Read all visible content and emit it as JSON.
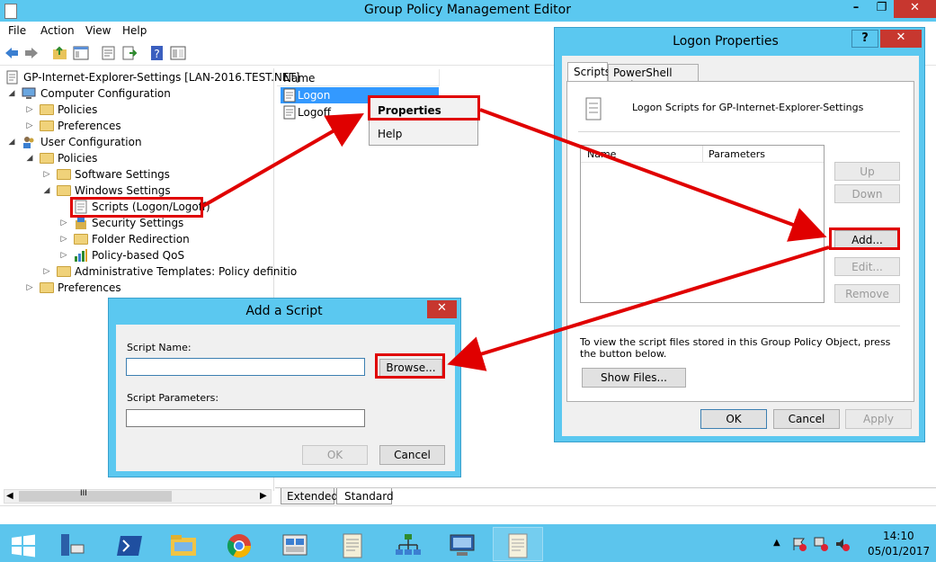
{
  "main_window": {
    "title": "Group Policy Management Editor",
    "menu": [
      "File",
      "Action",
      "View",
      "Help"
    ]
  },
  "tree": {
    "root": "GP-Internet-Explorer-Settings [LAN-2016.TEST.NET]",
    "computer_configuration": "Computer Configuration",
    "cc_policies": "Policies",
    "cc_preferences": "Preferences",
    "user_configuration": "User Configuration",
    "uc_policies": "Policies",
    "software_settings": "Software Settings",
    "windows_settings": "Windows Settings",
    "scripts": "Scripts (Logon/Logoff)",
    "security_settings": "Security Settings",
    "folder_redirection": "Folder Redirection",
    "policy_qos": "Policy-based QoS",
    "admin_templates": "Administrative Templates: Policy definitio",
    "uc_preferences": "Preferences"
  },
  "list": {
    "column_name": "Name",
    "items": [
      "Logon",
      "Logoff"
    ]
  },
  "context_menu": {
    "properties": "Properties",
    "help": "Help"
  },
  "bottom_tabs": {
    "extended": "Extended",
    "standard": "Standard"
  },
  "scroll": {
    "mid": "III"
  },
  "logon_dialog": {
    "title": "Logon Properties",
    "help_btn": "?",
    "tabs": [
      "Scripts",
      "PowerShell Scripts"
    ],
    "description": "Logon Scripts for GP-Internet-Explorer-Settings",
    "col_name": "Name",
    "col_params": "Parameters",
    "btn_up": "Up",
    "btn_down": "Down",
    "btn_add": "Add...",
    "btn_edit": "Edit...",
    "btn_remove": "Remove",
    "info_line1": "To view the script files stored in this Group Policy Object, press",
    "info_line2": "the button below.",
    "btn_show_files": "Show Files...",
    "btn_ok": "OK",
    "btn_cancel": "Cancel",
    "btn_apply": "Apply"
  },
  "add_script_dialog": {
    "title": "Add a Script",
    "script_name_label": "Script Name:",
    "script_name_value": "",
    "browse": "Browse...",
    "params_label": "Script Parameters:",
    "params_value": "",
    "btn_ok": "OK",
    "btn_cancel": "Cancel"
  },
  "taskbar": {
    "time": "14:10",
    "date": "05/01/2017"
  },
  "colors": {
    "titlebar": "#5bc8f0",
    "highlight": "#3399ff",
    "annotation": "#e00000",
    "close": "#c7372f",
    "taskbar": "#5cc5ed"
  }
}
